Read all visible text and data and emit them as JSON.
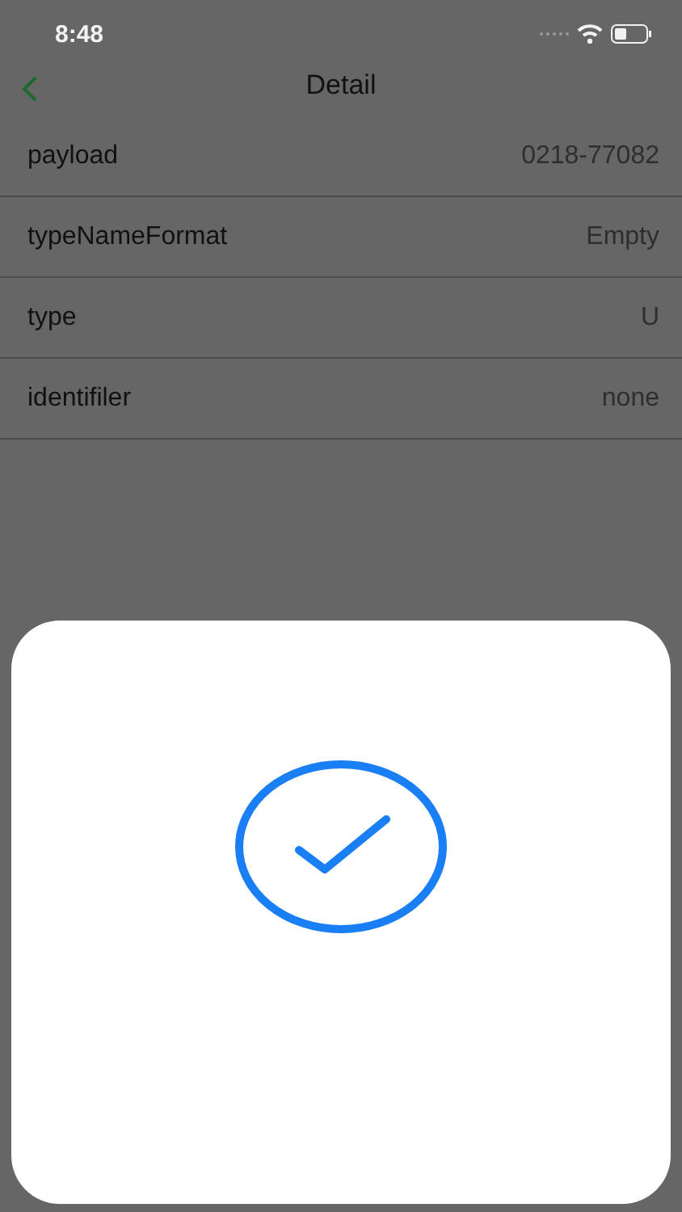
{
  "status_bar": {
    "time": "8:48"
  },
  "nav": {
    "title": "Detail"
  },
  "rows": [
    {
      "label": "payload",
      "value": "0218-77082"
    },
    {
      "label": "typeNameFormat",
      "value": "Empty"
    },
    {
      "label": "type",
      "value": "U"
    },
    {
      "label": "identifiler",
      "value": "none"
    }
  ]
}
